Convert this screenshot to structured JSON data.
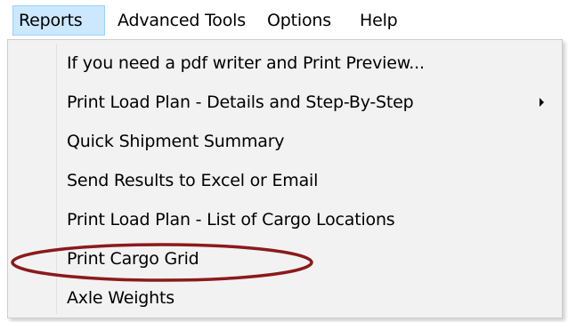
{
  "menubar": {
    "items": [
      {
        "label": "Reports"
      },
      {
        "label": "Advanced Tools"
      },
      {
        "label": "Options"
      },
      {
        "label": "Help"
      }
    ]
  },
  "dropdown": {
    "items": [
      {
        "label": "If you need a pdf writer and Print Preview..."
      },
      {
        "label": "Print Load Plan - Details and Step-By-Step",
        "has_submenu": true
      },
      {
        "label": "Quick Shipment Summary"
      },
      {
        "label": "Send Results to Excel or Email"
      },
      {
        "label": "Print Load Plan - List of Cargo Locations"
      },
      {
        "label": "Print Cargo Grid",
        "highlighted_by_annotation": true
      },
      {
        "label": "Axle Weights"
      }
    ]
  },
  "annotation": {
    "shape": "ellipse",
    "color": "#8b1a1a"
  }
}
